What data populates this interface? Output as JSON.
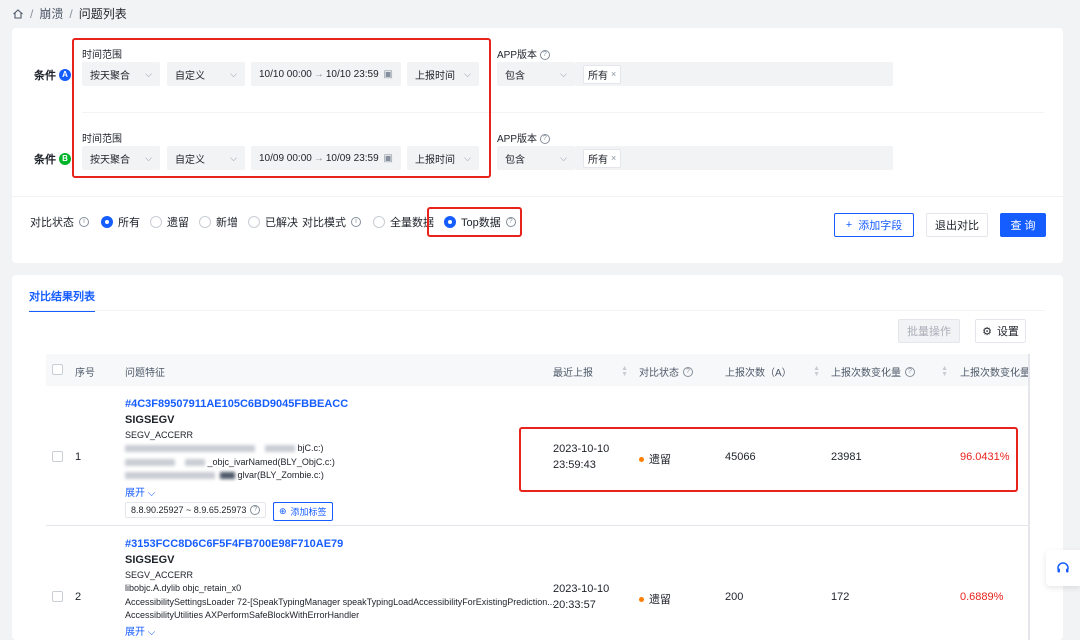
{
  "breadcrumb": {
    "items": [
      "崩溃",
      "问题列表"
    ]
  },
  "conditions": [
    {
      "name": "条件",
      "badge": "A",
      "time_label": "时间范围",
      "agg": "按天聚合",
      "mode": "自定义",
      "start": "10/10 00:00",
      "end": "10/10 23:59",
      "time_type": "上报时间",
      "app_label": "APP版本",
      "include": "包含",
      "value": "所有"
    },
    {
      "name": "条件",
      "badge": "B",
      "time_label": "时间范围",
      "agg": "按天聚合",
      "mode": "自定义",
      "start": "10/09 00:00",
      "end": "10/09 23:59",
      "time_type": "上报时间",
      "app_label": "APP版本",
      "include": "包含",
      "value": "所有"
    }
  ],
  "compare_status": {
    "label": "对比状态",
    "options": [
      "所有",
      "遗留",
      "新增",
      "已解决"
    ],
    "selected": 0
  },
  "compare_mode": {
    "label": "对比模式",
    "options": [
      "全量数据",
      "Top数据"
    ],
    "selected": 1
  },
  "actions": {
    "add_field": "添加字段",
    "exit_compare": "退出对比",
    "query": "查 询"
  },
  "results": {
    "tab": "对比结果列表",
    "batch": "批量操作",
    "settings": "设置",
    "columns": [
      "序号",
      "问题特征",
      "最近上报",
      "对比状态",
      "上报次数（A）",
      "上报次数变化量",
      "上报次数变化量"
    ],
    "rows": [
      {
        "index": "1",
        "hash": "#4C3F89507911AE105C6BD9045FBBEACC",
        "signal": "SIGSEGV",
        "code": "SEGV_ACCERR",
        "stack": [
          "bjC.c:)",
          "_objc_ivarNamed(BLY_ObjC.c:)",
          "glvar(BLY_Zombie.c:)"
        ],
        "expand": "展开",
        "version": "8.8.90.25927 ~ 8.9.65.25973",
        "add_tag": "添加标签",
        "date": "2023-10-10",
        "time": "23:59:43",
        "status": "遗留",
        "count_a": "45066",
        "delta": "23981",
        "delta_pct": "96.0431%"
      },
      {
        "index": "2",
        "hash": "#3153FCC8D6C6F5F4FB700E98F710AE79",
        "signal": "SIGSEGV",
        "code": "SEGV_ACCERR",
        "stack": [
          "libobjc.A.dylib objc_retain_x0",
          "AccessibilitySettingsLoader 72-[SpeakTypingManager speakTypingLoadAccessibilityForExistingPrediction...",
          "AccessibilityUtilities AXPerformSafeBlockWithErrorHandler"
        ],
        "expand": "展开",
        "date": "2023-10-10",
        "time": "20:33:57",
        "status": "遗留",
        "count_a": "200",
        "delta": "172",
        "delta_pct": "0.6889%"
      }
    ]
  },
  "colors": {
    "accent": "#165dff",
    "highlight": "#e8231c",
    "status_dot": "#ff7d00"
  }
}
